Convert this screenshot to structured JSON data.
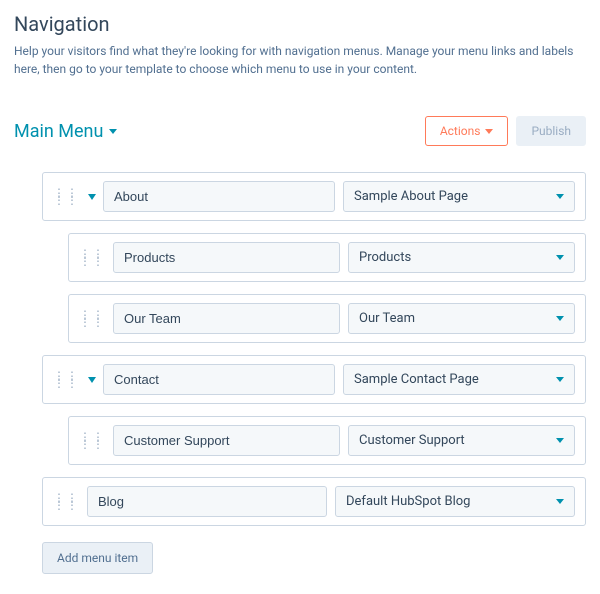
{
  "title": "Navigation",
  "subtitle": "Help your visitors find what they're looking for with navigation menus. Manage your menu links and labels here, then go to your template to choose which menu to use in your content.",
  "menuName": "Main Menu",
  "actionsLabel": "Actions",
  "publishLabel": "Publish",
  "addItemLabel": "Add menu item",
  "items": [
    {
      "label": "About",
      "page": "Sample About Page",
      "hasChildren": true,
      "indent": 0
    },
    {
      "label": "Products",
      "page": "Products",
      "hasChildren": false,
      "indent": 1
    },
    {
      "label": "Our Team",
      "page": "Our Team",
      "hasChildren": false,
      "indent": 1
    },
    {
      "label": "Contact",
      "page": "Sample Contact Page",
      "hasChildren": true,
      "indent": 0
    },
    {
      "label": "Customer Support",
      "page": "Customer Support",
      "hasChildren": false,
      "indent": 1
    },
    {
      "label": "Blog",
      "page": "Default HubSpot Blog",
      "hasChildren": false,
      "indent": 0
    }
  ]
}
